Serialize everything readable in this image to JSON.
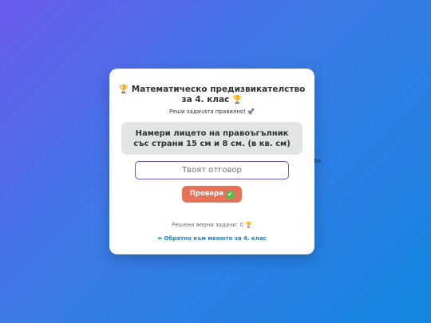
{
  "stray_text": "Бо",
  "card": {
    "title_icon": "🏆",
    "title": "Математическо предизвикателство за 4. клас",
    "subtitle": "Реши задачата правилно! 🚀",
    "problem": "Намери лицето на правоъгълник със страни 15 см и 8 см. (в кв. см)",
    "answer_input": {
      "value": "",
      "placeholder": "Твоят отговор"
    },
    "check_button_label": "Провери",
    "check_icon": "✔",
    "solved_label": "Решени верни задачи:",
    "solved_count": "0",
    "solved_icon": "🏆",
    "back_arrow": "⬅",
    "back_link": "Обратно към менюто за 4. клас"
  },
  "colors": {
    "background_start": "#6a5af0",
    "background_end": "#1286e0",
    "button": "#e57158",
    "link": "#1f7fc8",
    "input_border": "#6b56c2"
  },
  "icons": {
    "trophy": "trophy-icon",
    "rocket": "rocket-icon",
    "check": "check-mark-icon",
    "back": "back-arrow-icon"
  }
}
